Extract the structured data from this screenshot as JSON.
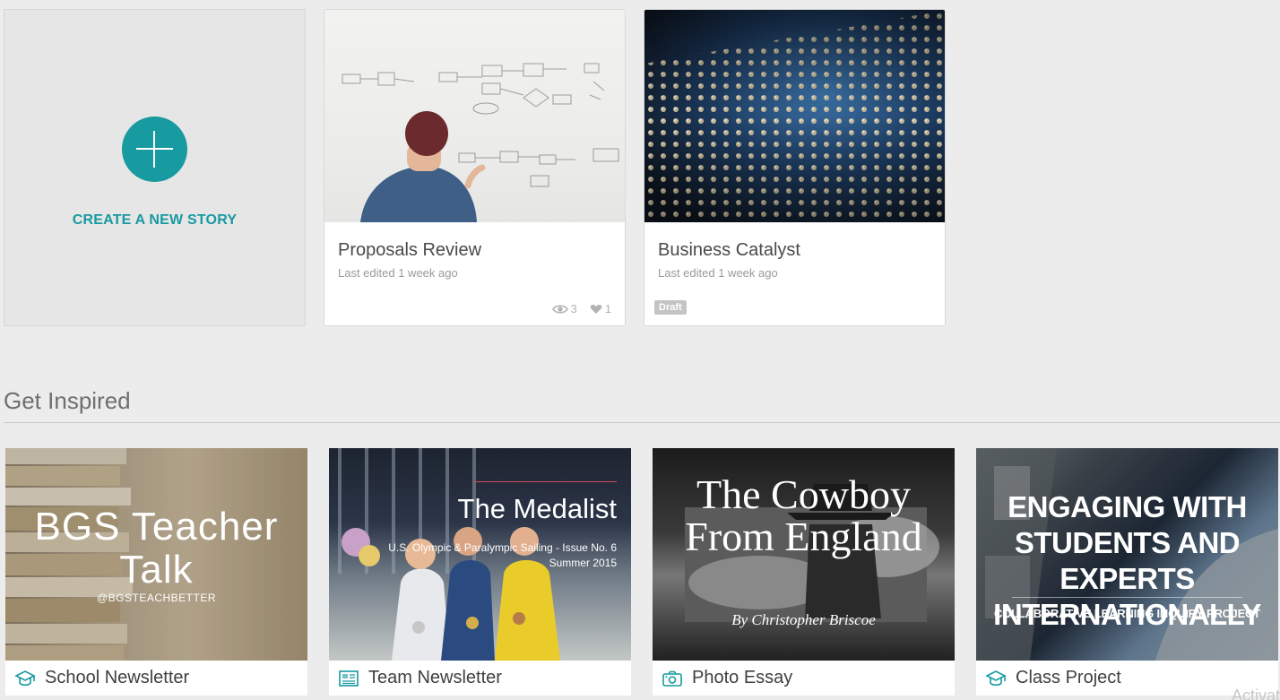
{
  "create": {
    "label": "CREATE A NEW STORY"
  },
  "stories": [
    {
      "title": "Proposals Review",
      "meta": "Last edited 1 week ago",
      "views": "3",
      "likes": "1"
    },
    {
      "title": "Business Catalyst",
      "meta": "Last edited 1 week ago",
      "badge": "Draft"
    }
  ],
  "inspired": {
    "title": "Get Inspired",
    "templates": [
      {
        "label": "School Newsletter",
        "icon": "graduation-cap-icon",
        "image_title": "BGS Teacher Talk",
        "image_sub": "@BGSTEACHBETTER"
      },
      {
        "label": "Team Newsletter",
        "icon": "newsletter-icon",
        "image_title": "The Medalist",
        "image_sub": "U.S. Olympic & Paralympic Sailing - Issue No. 6 Summer 2015"
      },
      {
        "label": "Photo Essay",
        "icon": "camera-icon",
        "image_title": "The Cowboy From England",
        "image_sub": "By Christopher Briscoe"
      },
      {
        "label": "Class Project",
        "icon": "graduation-cap-icon",
        "image_title": "ENGAGING WITH STUDENTS AND EXPERTS INTERNATIONALLY",
        "image_sub": "COLLABORATIVE LEARNING INQUIRY PROJECT"
      }
    ]
  },
  "footer": {
    "watermark": "Activat"
  },
  "colors": {
    "accent": "#179aa0",
    "background": "#ececec"
  }
}
